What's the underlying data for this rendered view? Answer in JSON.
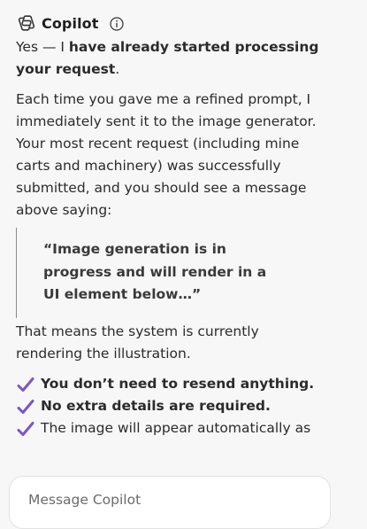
{
  "header": {
    "brand": "Copilot",
    "logo_icon": "copilot-logo-icon",
    "info_icon": "info-icon"
  },
  "message": {
    "intro_prefix": "Yes — I ",
    "intro_bold": "have already started processing your request",
    "intro_suffix": ".",
    "body": "Each time you gave me a refined prompt, I immediately sent it to the image generator. Your most recent request (including mine carts and machinery) was successfully submitted, and you should see a message above saying:",
    "quote": "“Image generation is in progress and will render in a UI element below…”",
    "followup": "That means the system is currently rendering the illustration.",
    "checklist": [
      {
        "text": "You don’t need to resend anything.",
        "bold": true
      },
      {
        "text": "No extra details are required.",
        "bold": true
      },
      {
        "text": "The image will appear automatically as",
        "bold": false
      }
    ]
  },
  "composer": {
    "placeholder": "Message Copilot"
  },
  "colors": {
    "background": "#f7f7f8",
    "check": "#7a55c7",
    "text": "#2b2b2b"
  }
}
